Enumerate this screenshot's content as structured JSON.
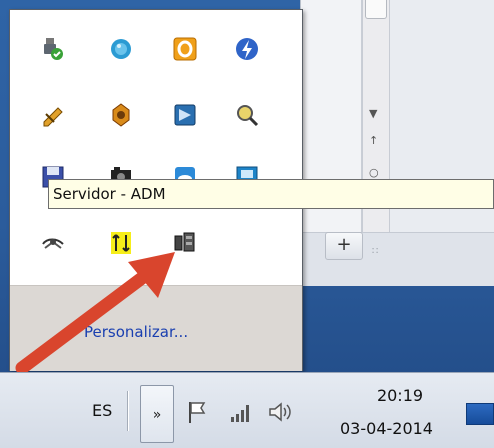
{
  "tooltip": {
    "text": "Servidor - ADM"
  },
  "popup": {
    "customize_label": "Personalizar..."
  },
  "taskbar": {
    "language": "ES",
    "show_hidden_glyph": "»",
    "time": "20:19",
    "date": "03-04-2014"
  },
  "background_window": {
    "zoom_glyph": "+",
    "scroll_up": "▼",
    "scroll_pageup": "↑",
    "grip": "∷"
  },
  "tray_icons": [
    "usb-safe-remove-icon",
    "globe-circle-icon",
    "office-o-icon",
    "lightning-icon",
    "pencil-tool-icon",
    "gear-shield-icon",
    "remote-desktop-icon",
    "magnifier-icon",
    "floppy-save-icon",
    "camera-icon",
    "cloud-icon",
    "fx-icon",
    "eye-network-icon",
    "transfer-yellow-icon",
    "server-adm-icon"
  ],
  "colors": {
    "arrow": "#d9452d",
    "tooltip_bg": "#fffee6",
    "link": "#1a3fb0"
  }
}
